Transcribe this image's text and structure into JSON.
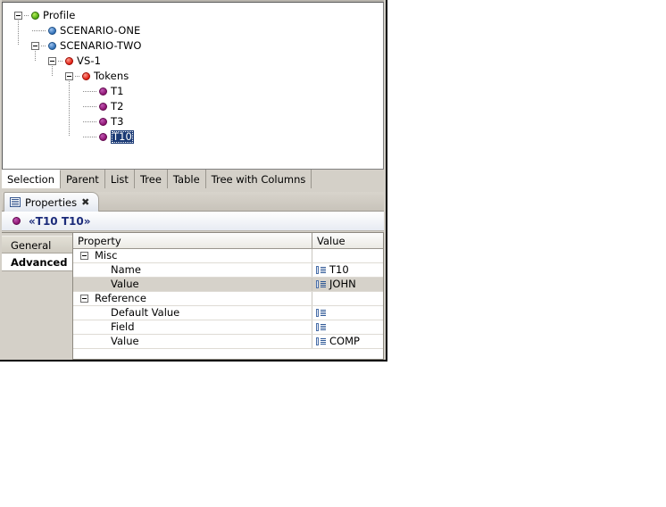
{
  "tree": {
    "nodes": [
      {
        "label": "Profile",
        "icon": "green-sphere-icon",
        "depth": 0,
        "expander": "collapse",
        "selected": false
      },
      {
        "label": "SCENARIO-ONE",
        "icon": "blue-sphere-icon",
        "depth": 1,
        "expander": "none",
        "selected": false
      },
      {
        "label": "SCENARIO-TWO",
        "icon": "blue-sphere-icon",
        "depth": 1,
        "expander": "collapse",
        "selected": false
      },
      {
        "label": "VS-1",
        "icon": "red-sphere-icon",
        "depth": 2,
        "expander": "collapse",
        "selected": false
      },
      {
        "label": "Tokens",
        "icon": "red-sphere-icon",
        "depth": 3,
        "expander": "collapse",
        "selected": false
      },
      {
        "label": "T1",
        "icon": "purple-sphere-icon",
        "depth": 4,
        "expander": "none",
        "selected": false
      },
      {
        "label": "T2",
        "icon": "purple-sphere-icon",
        "depth": 4,
        "expander": "none",
        "selected": false
      },
      {
        "label": "T3",
        "icon": "purple-sphere-icon",
        "depth": 4,
        "expander": "none",
        "selected": false
      },
      {
        "label": "T10",
        "icon": "purple-sphere-icon",
        "depth": 4,
        "expander": "none",
        "selected": true
      }
    ]
  },
  "view_tabs": {
    "active": "Selection",
    "items": [
      {
        "label": "Selection"
      },
      {
        "label": "Parent"
      },
      {
        "label": "List"
      },
      {
        "label": "Tree"
      },
      {
        "label": "Table"
      },
      {
        "label": "Tree with Columns"
      }
    ]
  },
  "properties_view": {
    "tab": {
      "label": "Properties",
      "icon": "properties-list-icon",
      "close_glyph": "✖"
    },
    "title": {
      "icon": "purple-sphere-icon",
      "text": "«T10 T10»"
    },
    "side_tabs": {
      "active": "Advanced",
      "items": [
        {
          "label": "General"
        },
        {
          "label": "Advanced"
        }
      ]
    },
    "grid": {
      "columns": [
        "Property",
        "Value"
      ],
      "rows": [
        {
          "kind": "group",
          "property": "Misc",
          "value": "",
          "value_icon": false,
          "expander": "collapse",
          "highlight": false
        },
        {
          "kind": "child",
          "property": "Name",
          "value": "T10",
          "value_icon": true,
          "expander": "none",
          "highlight": false
        },
        {
          "kind": "child",
          "property": "Value",
          "value": "JOHN",
          "value_icon": true,
          "expander": "none",
          "highlight": true
        },
        {
          "kind": "group",
          "property": "Reference",
          "value": "",
          "value_icon": false,
          "expander": "collapse",
          "highlight": false
        },
        {
          "kind": "child",
          "property": "Default Value",
          "value": "",
          "value_icon": true,
          "expander": "none",
          "highlight": false
        },
        {
          "kind": "child",
          "property": "Field",
          "value": "",
          "value_icon": true,
          "expander": "none",
          "highlight": false
        },
        {
          "kind": "child",
          "property": "Value",
          "value": "COMP",
          "value_icon": true,
          "expander": "none",
          "highlight": false
        }
      ]
    }
  },
  "colors": {
    "selection_blue": "#1b3a75",
    "title_text": "#1b2b7a",
    "panel_bg": "#d4d0c8",
    "row_highlight": "#d6d2ca",
    "node_green": "#4ca80e",
    "node_blue": "#2d6db5",
    "node_red": "#e01c10",
    "node_purple": "#8c126f"
  }
}
